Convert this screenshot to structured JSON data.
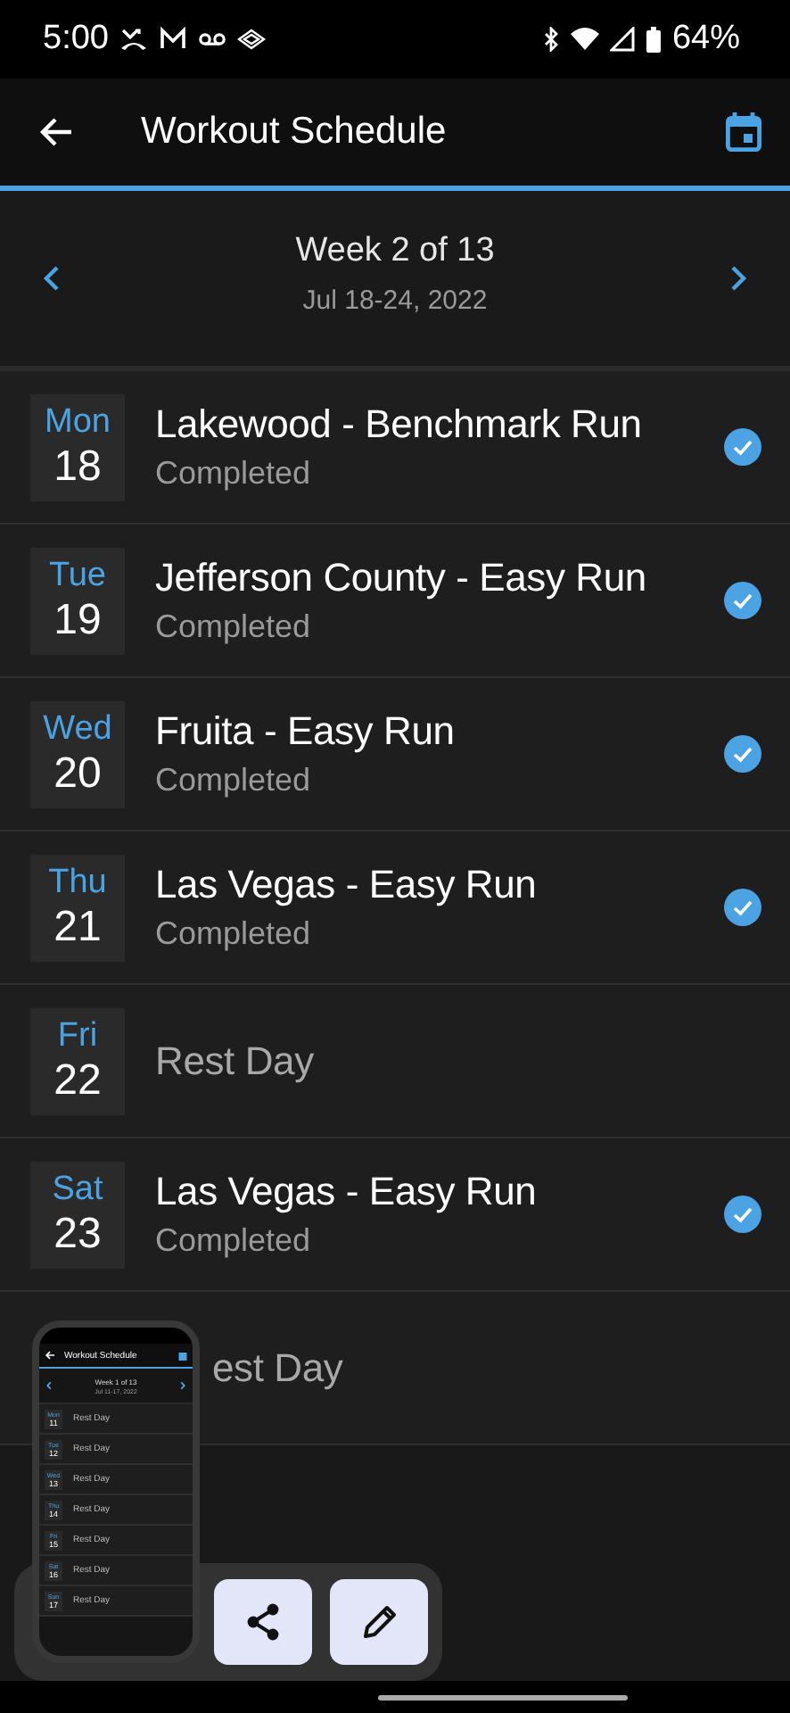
{
  "status_bar": {
    "time": "5:00",
    "battery": "64%"
  },
  "app_bar": {
    "title": "Workout Schedule"
  },
  "week": {
    "label": "Week 2 of 13",
    "dates": "Jul 18-24, 2022"
  },
  "days": [
    {
      "kind": "workout",
      "day": "Mon",
      "date": "18",
      "title": "Lakewood - Benchmark Run",
      "subtitle": "Completed",
      "completed": true
    },
    {
      "kind": "workout",
      "day": "Tue",
      "date": "19",
      "title": "Jefferson County - Easy Run",
      "subtitle": "Completed",
      "completed": true
    },
    {
      "kind": "workout",
      "day": "Wed",
      "date": "20",
      "title": "Fruita - Easy Run",
      "subtitle": "Completed",
      "completed": true
    },
    {
      "kind": "workout",
      "day": "Thu",
      "date": "21",
      "title": "Las Vegas - Easy Run",
      "subtitle": "Completed",
      "completed": true
    },
    {
      "kind": "rest",
      "day": "Fri",
      "date": "22",
      "title": "Rest Day"
    },
    {
      "kind": "workout",
      "day": "Sat",
      "date": "23",
      "title": "Las Vegas - Easy Run",
      "subtitle": "Completed",
      "completed": true
    }
  ],
  "covered_row": {
    "title": "est Day"
  },
  "screenshot_preview": {
    "title": "Workout Schedule",
    "week": "Week 1 of 13",
    "dates": "Jul 11-17, 2022",
    "days": [
      {
        "day": "Mon",
        "date": "11",
        "title": "Rest Day"
      },
      {
        "day": "Tue",
        "date": "12",
        "title": "Rest Day"
      },
      {
        "day": "Wed",
        "date": "13",
        "title": "Rest Day"
      },
      {
        "day": "Thu",
        "date": "14",
        "title": "Rest Day"
      },
      {
        "day": "Fri",
        "date": "15",
        "title": "Rest Day"
      },
      {
        "day": "Sat",
        "date": "16",
        "title": "Rest Day"
      },
      {
        "day": "Sun",
        "date": "17",
        "title": "Rest Day"
      }
    ]
  }
}
